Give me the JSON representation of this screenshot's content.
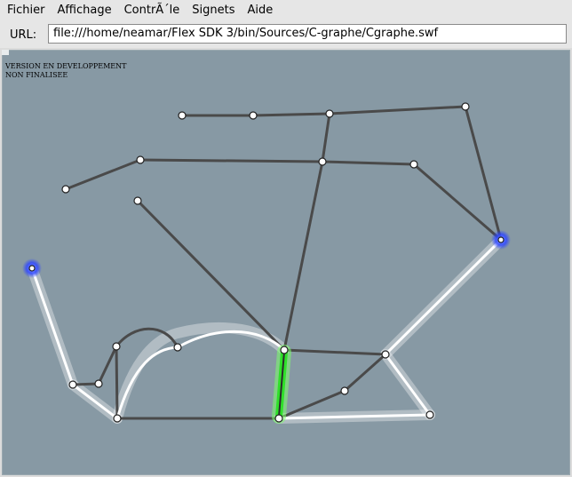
{
  "menu": {
    "items": [
      "Fichier",
      "Affichage",
      "ContrÃ´le",
      "Signets",
      "Aide"
    ]
  },
  "urlbar": {
    "label": "URL:",
    "value": "file:///home/neamar/Flex SDK 3/bin/Sources/C-graphe/Cgraphe.swf"
  },
  "notice": {
    "line1": "VERSION EN DEVELOPPEMENT",
    "line2": "NON FINALISEE"
  },
  "colors": {
    "background": "#8799a4",
    "edge": "#4a4a4a",
    "path_edge": "#ffffff",
    "selected_edge": "#2fe02a",
    "endpoint": "#3350ff",
    "node": "#ffffff"
  }
}
